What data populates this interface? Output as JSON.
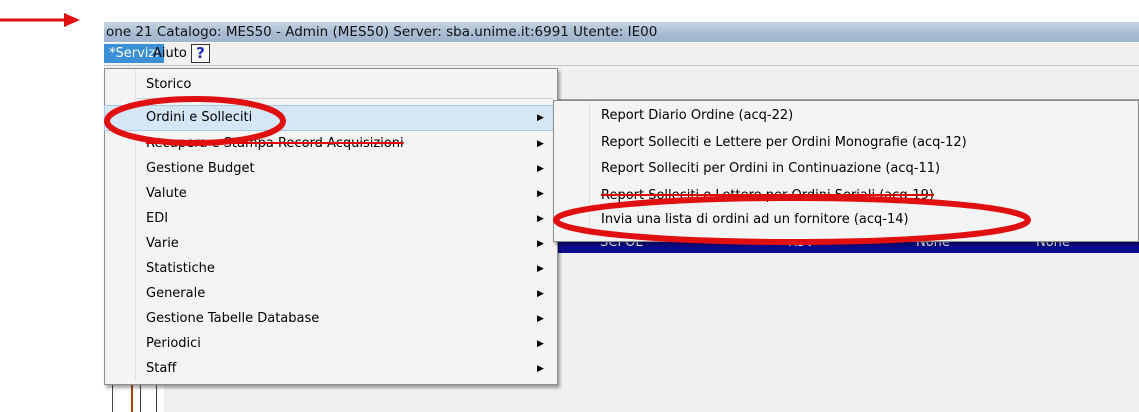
{
  "window": {
    "title": "one 21  Catalogo:  MES50 - Admin (MES50)  Server:  sba.unime.it:6991  Utente:  IE00"
  },
  "menubar": {
    "items": [
      {
        "label": "*Servizi"
      },
      {
        "label": "Aiuto"
      }
    ],
    "help_glyph": "?"
  },
  "servizi_menu": {
    "items": [
      {
        "label": "Storico",
        "submenu": false
      },
      {
        "label": "Ordini e Solleciti",
        "submenu": true,
        "highlighted": true
      },
      {
        "label": "Recupera e Stampa Record Acquisizioni",
        "submenu": true
      },
      {
        "label": "Gestione Budget",
        "submenu": true
      },
      {
        "label": "Valute",
        "submenu": true
      },
      {
        "label": "EDI",
        "submenu": true
      },
      {
        "label": "Varie",
        "submenu": true
      },
      {
        "label": "Statistiche",
        "submenu": true
      },
      {
        "label": "Generale",
        "submenu": true
      },
      {
        "label": "Gestione Tabelle Database",
        "submenu": true
      },
      {
        "label": "Periodici",
        "submenu": true
      },
      {
        "label": "Staff",
        "submenu": true
      }
    ],
    "submenu_glyph": "▶"
  },
  "ordini_submenu": {
    "items": [
      {
        "label": "Report Diario Ordine (acq-22)"
      },
      {
        "label": "Report Solleciti e Lettere per Ordini Monografie (acq-12)"
      },
      {
        "label": "Report Solleciti per Ordini in Continuazione (acq-11)"
      },
      {
        "label": "Report Solleciti e Lettere per Ordini Seriali (acq-19)"
      },
      {
        "label": "Invia una lista di ordini ad un fornitore (acq-14)"
      }
    ]
  },
  "background_table_row": {
    "cells": [
      "SCPOL",
      "RSV",
      "None",
      "None"
    ]
  },
  "annotations": {
    "arrow_color": "#e01010",
    "oval_color": "#e01010"
  },
  "colors": {
    "title_bar": "#a9bdd3",
    "menu_selected": "#3a8fd6",
    "menu_hover": "#d5e6f7",
    "table_row": "#0b0b8e"
  }
}
